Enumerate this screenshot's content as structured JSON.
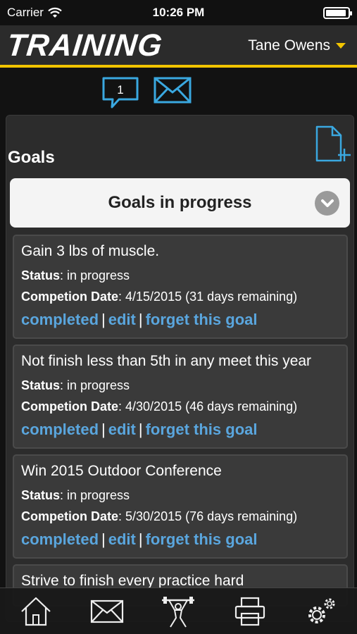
{
  "status_bar": {
    "carrier": "Carrier",
    "time": "10:26 PM"
  },
  "header": {
    "logo": "TRAINING",
    "user_name": "Tane Owens"
  },
  "messages": {
    "unread_count": "1"
  },
  "goals": {
    "title": "Goals",
    "filter": {
      "selected": "Goals in progress"
    },
    "items": [
      {
        "title": "Gain 3 lbs of muscle.",
        "status_label": "Status",
        "status": ": in progress",
        "date_label": "Competion Date",
        "date": ": 4/15/2015 (31 days remaining)",
        "completed": "completed",
        "edit": "edit",
        "forget": "forget this goal"
      },
      {
        "title": "Not finish less than 5th in any meet this year",
        "status_label": "Status",
        "status": ": in progress",
        "date_label": "Competion Date",
        "date": ": 4/30/2015 (46 days remaining)",
        "completed": "completed",
        "edit": "edit",
        "forget": "forget this goal"
      },
      {
        "title": "Win 2015 Outdoor Conference",
        "status_label": "Status",
        "status": ": in progress",
        "date_label": "Competion Date",
        "date": ": 5/30/2015 (76 days remaining)",
        "completed": "completed",
        "edit": "edit",
        "forget": "forget this goal"
      },
      {
        "title": "Strive to finish every practice hard"
      }
    ],
    "separator": "|"
  },
  "tabbar": {
    "icons": [
      "home-icon",
      "mail-icon",
      "athlete-icon",
      "print-icon",
      "settings-icon"
    ]
  },
  "colors": {
    "accent": "#f2c400",
    "link": "#5aa6de",
    "icon_blue": "#3aa8e0"
  }
}
